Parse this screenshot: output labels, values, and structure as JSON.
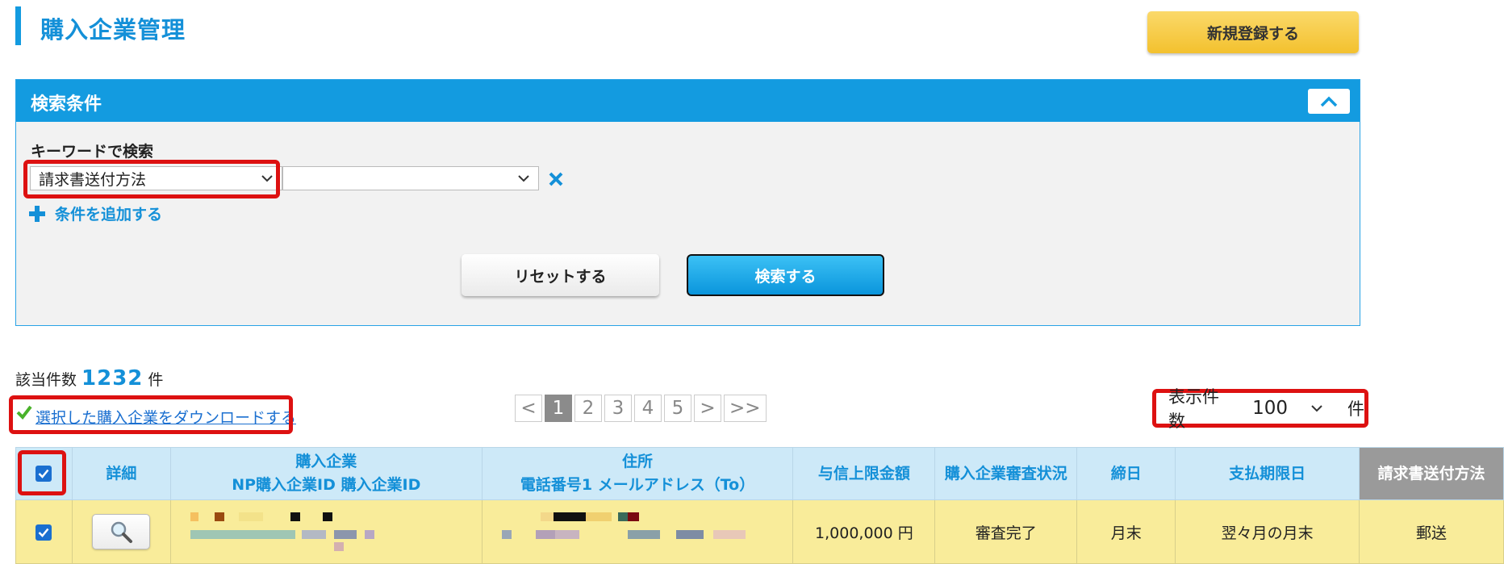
{
  "header": {
    "title": "購入企業管理",
    "new_button": "新規登録する"
  },
  "search_panel": {
    "title": "検索条件",
    "keyword_label": "キーワードで検索",
    "field_select_value": "請求書送付方法",
    "value_select_value": "",
    "add_condition": "条件を追加する",
    "reset_button": "リセットする",
    "search_button": "検索する"
  },
  "results": {
    "count_label": "該当件数",
    "count": "1232",
    "count_unit": "件",
    "download_link": "選択した購入企業をダウンロードする",
    "per_page_label": "表示件数",
    "per_page_value": "100",
    "per_page_unit": "件"
  },
  "pagination": {
    "prev": "<",
    "pages": [
      "1",
      "2",
      "3",
      "4",
      "5"
    ],
    "current": "1",
    "next": ">",
    "last": ">>"
  },
  "table": {
    "headers": {
      "detail": "詳細",
      "company_line1": "購入企業",
      "company_line2": "NP購入企業ID 購入企業ID",
      "address_line1": "住所",
      "address_line2": "電話番号1 メールアドレス（To）",
      "credit_limit": "与信上限金額",
      "review_status": "購入企業審査状況",
      "closing_date": "締日",
      "payment_due": "支払期限日",
      "invoice_method": "請求書送付方法"
    },
    "rows": [
      {
        "credit_limit": "1,000,000 円",
        "review_status": "審査完了",
        "closing_date": "月末",
        "payment_due": "翌々月の月末",
        "invoice_method": "郵送"
      }
    ]
  },
  "colors": {
    "accent": "#139be0",
    "highlight": "#dd1111",
    "row_bg": "#f9ec9a",
    "header_bg": "#cde9f8"
  }
}
